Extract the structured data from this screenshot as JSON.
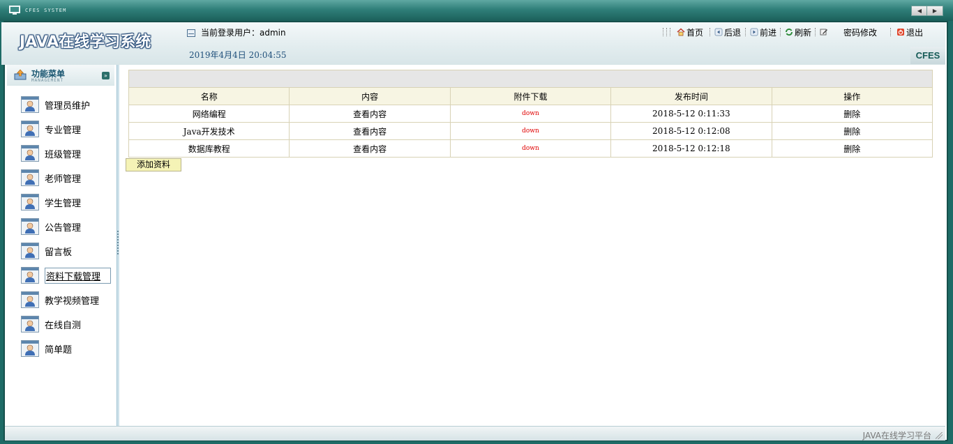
{
  "window": {
    "title": "CFES SYSTEM",
    "prev_label": "◀",
    "next_label": "▶"
  },
  "header": {
    "logo": "JAVA在线学习系统",
    "login_label": "当前登录用户：admin",
    "datetime": "2019年4月4日  20:04:55",
    "brand": "CFES",
    "toolbar": {
      "home": "首页",
      "back": "后退",
      "forward": "前进",
      "refresh": "刷新",
      "password": "密码修改",
      "logout": "退出"
    }
  },
  "sidebar": {
    "title": "功能菜单",
    "subtitle": "MANAGEMENT",
    "items": [
      {
        "label": "管理员维护"
      },
      {
        "label": "专业管理"
      },
      {
        "label": "班级管理"
      },
      {
        "label": "老师管理"
      },
      {
        "label": "学生管理"
      },
      {
        "label": "公告管理"
      },
      {
        "label": "留言板"
      },
      {
        "label": "资料下载管理"
      },
      {
        "label": "教学视频管理"
      },
      {
        "label": "在线自测"
      },
      {
        "label": "简单题"
      }
    ]
  },
  "table": {
    "headers": [
      "名称",
      "内容",
      "附件下载",
      "发布时间",
      "操作"
    ],
    "rows": [
      [
        "网络编程",
        "查看内容",
        "down",
        "2018-5-12 0:11:33",
        "删除"
      ],
      [
        "Java开发技术",
        "查看内容",
        "down",
        "2018-5-12 0:12:08",
        "删除"
      ],
      [
        "数据库教程",
        "查看内容",
        "down",
        "2018-5-12 0:12:18",
        "删除"
      ]
    ]
  },
  "add_button": "添加资料",
  "footer": {
    "text": "JAVA在线学习平台"
  },
  "colors": {
    "frame": "#1e6b66",
    "accent_red": "#e00000",
    "header_bg": "#f7f5e3"
  }
}
